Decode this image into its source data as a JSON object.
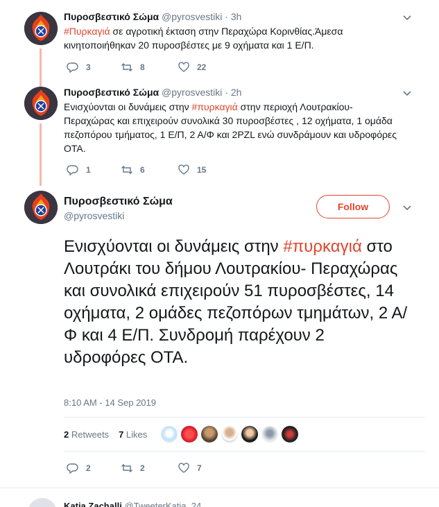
{
  "colors": {
    "accent": "#e0462d",
    "muted": "#657786",
    "text": "#14171a",
    "thread": "#f6b8aa"
  },
  "tweets": [
    {
      "name": "Πυροσβεστικό Σώμα",
      "handle": "@pyrosvestiki",
      "time": "· 3h",
      "hashtag": "#Πυρκαγιά",
      "text": " σε αγροτική έκταση στην Περαχώρα Κορινθίας.Άμεσα κινητοποιήθηκαν 20 πυροσβέστες με 9 οχήματα και 1 Ε/Π.",
      "replies": "3",
      "retweets": "8",
      "likes": "22"
    },
    {
      "name": "Πυροσβεστικό Σώμα",
      "handle": "@pyrosvestiki",
      "time": "· 2h",
      "text_before": "Ενισχύονται οι δυνάμεις στην ",
      "hashtag": "#πυρκαγιά",
      "text": " στην περιοχή Λουτρακίου-Περαχώρας και επιχειρούν συνολικά 30 πυροσβέστες , 12 οχήματα, 1 ομάδα πεζοπόρου τμήματος, 1 Ε/Π, 2 Α/Φ και 2PZL ενώ συνδράμουν  και υδροφόρες ΟΤΑ.",
      "replies": "1",
      "retweets": "6",
      "likes": "15"
    }
  ],
  "main": {
    "name": "Πυροσβεστικό Σώμα",
    "handle": "@pyrosvestiki",
    "follow_label": "Follow",
    "text_before": "Ενισχύονται οι δυνάμεις στην ",
    "hashtag": "#πυρκαγιά",
    "text": " στο Λουτράκι του δήμου Λουτρακίου- Περαχώρας και συνολικά επιχειρούν 51 πυροσβέστες, 14 οχήματα, 2 ομάδες πεζοπόρων τμημάτων, 2 Α/Φ και 4 Ε/Π. Συνδρομή παρέχουν 2 υδροφόρες ΟΤΑ.",
    "timestamp": "8:10 AM - 14 Sep 2019",
    "retweets_count": "2",
    "retweets_label": "Retweets",
    "likes_count": "7",
    "likes_label": "Likes",
    "replies": "2",
    "retweets": "2",
    "likes": "7"
  },
  "next_tweet": {
    "name": "Katia Zachalli",
    "handle": "@TweeterKatia_24"
  }
}
